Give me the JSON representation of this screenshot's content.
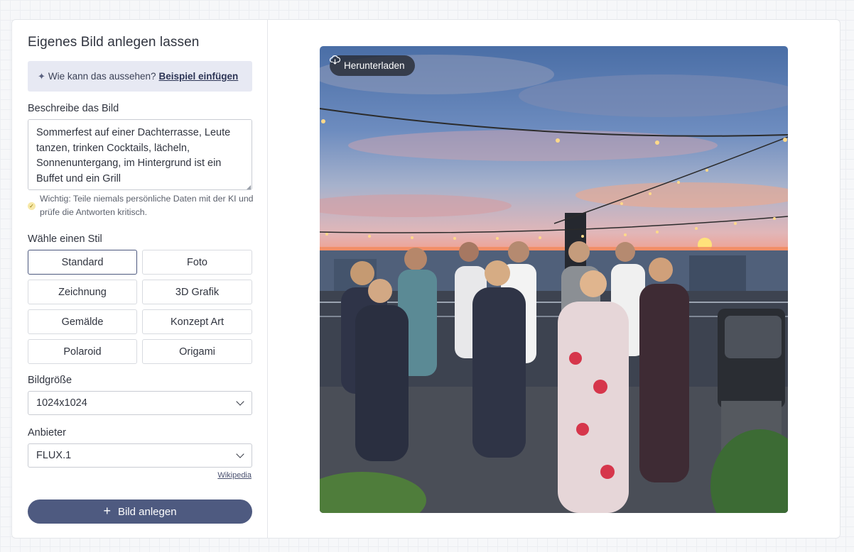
{
  "form": {
    "title": "Eigenes Bild anlegen lassen",
    "hint_text": "Wie kann das aussehen?",
    "hint_link": "Beispiel einfügen",
    "description_label": "Beschreibe das Bild",
    "description_value": "Sommerfest auf einer Dachterrasse, Leute tanzen, trinken Cocktails, lächeln, Sonnenuntergang, im Hintergrund ist ein Buffet und ein Grill",
    "warning": "Wichtig: Teile niemals persönliche Daten mit der KI und prüfe die Antworten kritisch.",
    "style_label": "Wähle einen Stil",
    "styles": [
      {
        "label": "Standard",
        "active": true
      },
      {
        "label": "Foto"
      },
      {
        "label": "Zeichnung"
      },
      {
        "label": "3D Grafik"
      },
      {
        "label": "Gemälde"
      },
      {
        "label": "Konzept Art"
      },
      {
        "label": "Polaroid"
      },
      {
        "label": "Origami"
      }
    ],
    "size_label": "Bildgröße",
    "size_value": "1024x1024",
    "provider_label": "Anbieter",
    "provider_value": "FLUX.1",
    "wiki_link": "Wikipedia",
    "create_button": "Bild anlegen"
  },
  "preview": {
    "download_label": "Herunterladen"
  },
  "colors": {
    "accent": "#4e5a80",
    "hint_bg": "#e7e9f3"
  }
}
